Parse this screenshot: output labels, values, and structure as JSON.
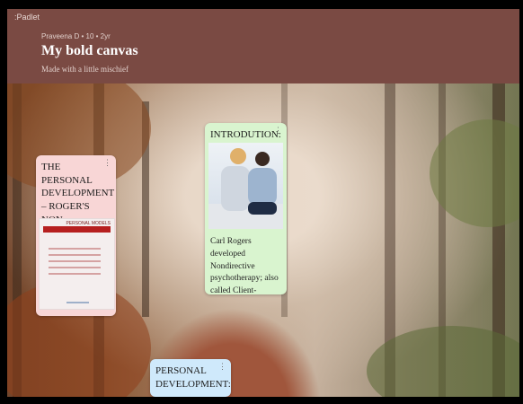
{
  "app": {
    "brand": ":Padlet"
  },
  "header": {
    "meta": "Praveena D • 10 • 2yr",
    "title": "My bold canvas",
    "subtitle": "Made with a little mischief"
  },
  "cards": {
    "personal_model": {
      "title": "THE PERSONAL DEVELOPMENT – ROGER'S NON-DIRECTIVE MODEL",
      "thumb_label": "PERSONAL MODELS"
    },
    "introduction": {
      "title": "INTRODUTION:",
      "text": "Carl Rogers developed Nondirective psychotherapy; also called Client-centered therapy ."
    },
    "personal_development": {
      "title": "PERSONAL DEVELOPMENT:"
    }
  },
  "menu_glyph": "⋮",
  "colors": {
    "header": "#7a4a43",
    "pink_card": "#f8d6d6",
    "green_card": "#d9f4cf",
    "blue_card": "#cfe9fb"
  }
}
